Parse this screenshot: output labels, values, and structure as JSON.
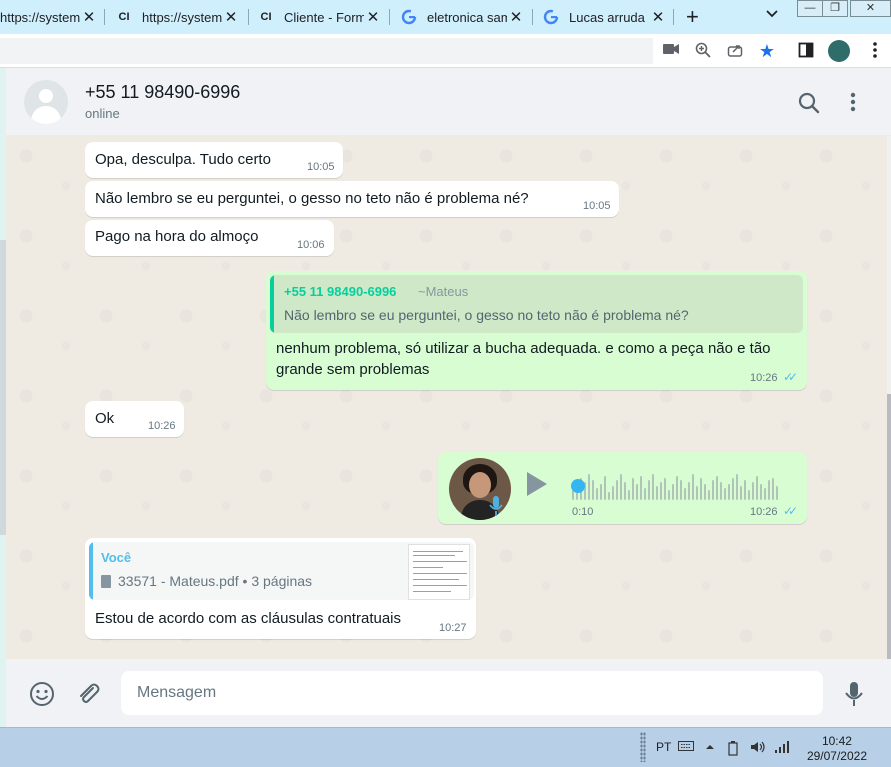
{
  "browser": {
    "tabs": [
      {
        "title": "https://system",
        "icon": "none"
      },
      {
        "title": "https://system",
        "icon": "ci-icon"
      },
      {
        "title": "Cliente - Form",
        "icon": "ci-icon"
      },
      {
        "title": "eletronica sam",
        "icon": "google-icon"
      },
      {
        "title": "Lucas arruda p",
        "icon": "google-icon"
      }
    ],
    "new_tab": "+",
    "tab_list": "⌄"
  },
  "chat": {
    "contact_name": "+55 11 98490-6996",
    "contact_status": "online",
    "messages": [
      {
        "dir": "in",
        "text": "Opa, desculpa. Tudo certo",
        "time": "10:05"
      },
      {
        "dir": "in",
        "text": "Não lembro se eu perguntei,  o gesso no teto não é problema né?",
        "time": "10:05"
      },
      {
        "dir": "in",
        "text": "Pago na hora do almoço",
        "time": "10:06"
      },
      {
        "dir": "out",
        "quote": {
          "name": "+55 11 98490-6996",
          "pushname": "~Mateus",
          "text": "Não lembro se eu perguntei,  o gesso no teto não é problema né?"
        },
        "text_line1": "nenhum problema, só utilizar a bucha adequada. e como a peça não e tão",
        "text_line2": "grande sem problemas",
        "time": "10:26",
        "status": "read"
      },
      {
        "dir": "in",
        "text": "Ok",
        "time": "10:26"
      },
      {
        "dir": "out",
        "type": "audio",
        "duration": "0:10",
        "time": "10:26",
        "status": "read"
      },
      {
        "dir": "in",
        "reply": {
          "name": "Você",
          "file": "33571 - Mateus.pdf • 3 páginas"
        },
        "text": "Estou de acordo com as cláusulas contratuais",
        "time": "10:27"
      }
    ]
  },
  "composer": {
    "placeholder": "Mensagem"
  },
  "taskbar": {
    "lang": "PT",
    "time": "10:42",
    "date": "29/07/2022"
  },
  "colors": {
    "outgoing_bubble": "#d9fdd3",
    "incoming_bubble": "#ffffff",
    "read_ticks": "#53bdeb",
    "quote_name": "#06cf9c",
    "tab_bar": "#cfeffd"
  }
}
